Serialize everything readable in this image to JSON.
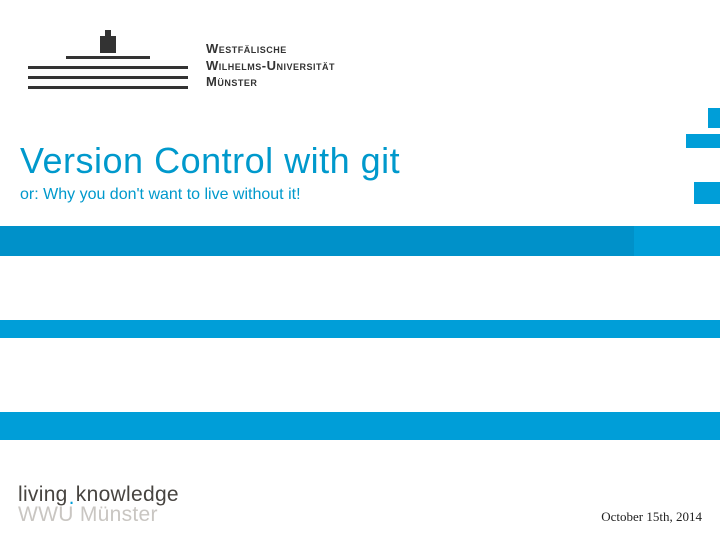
{
  "university": {
    "line1": "Westfälische",
    "line2": "Wilhelms-Universität",
    "line3": "Münster"
  },
  "title": "Version Control with git",
  "subtitle": "or: Why you don't want to live without it!",
  "footer": {
    "slogan_left": "living",
    "slogan_right": "knowledge",
    "institution": "WWU Münster",
    "date": "October 15th, 2014"
  },
  "colors": {
    "accent": "#009ed8"
  }
}
